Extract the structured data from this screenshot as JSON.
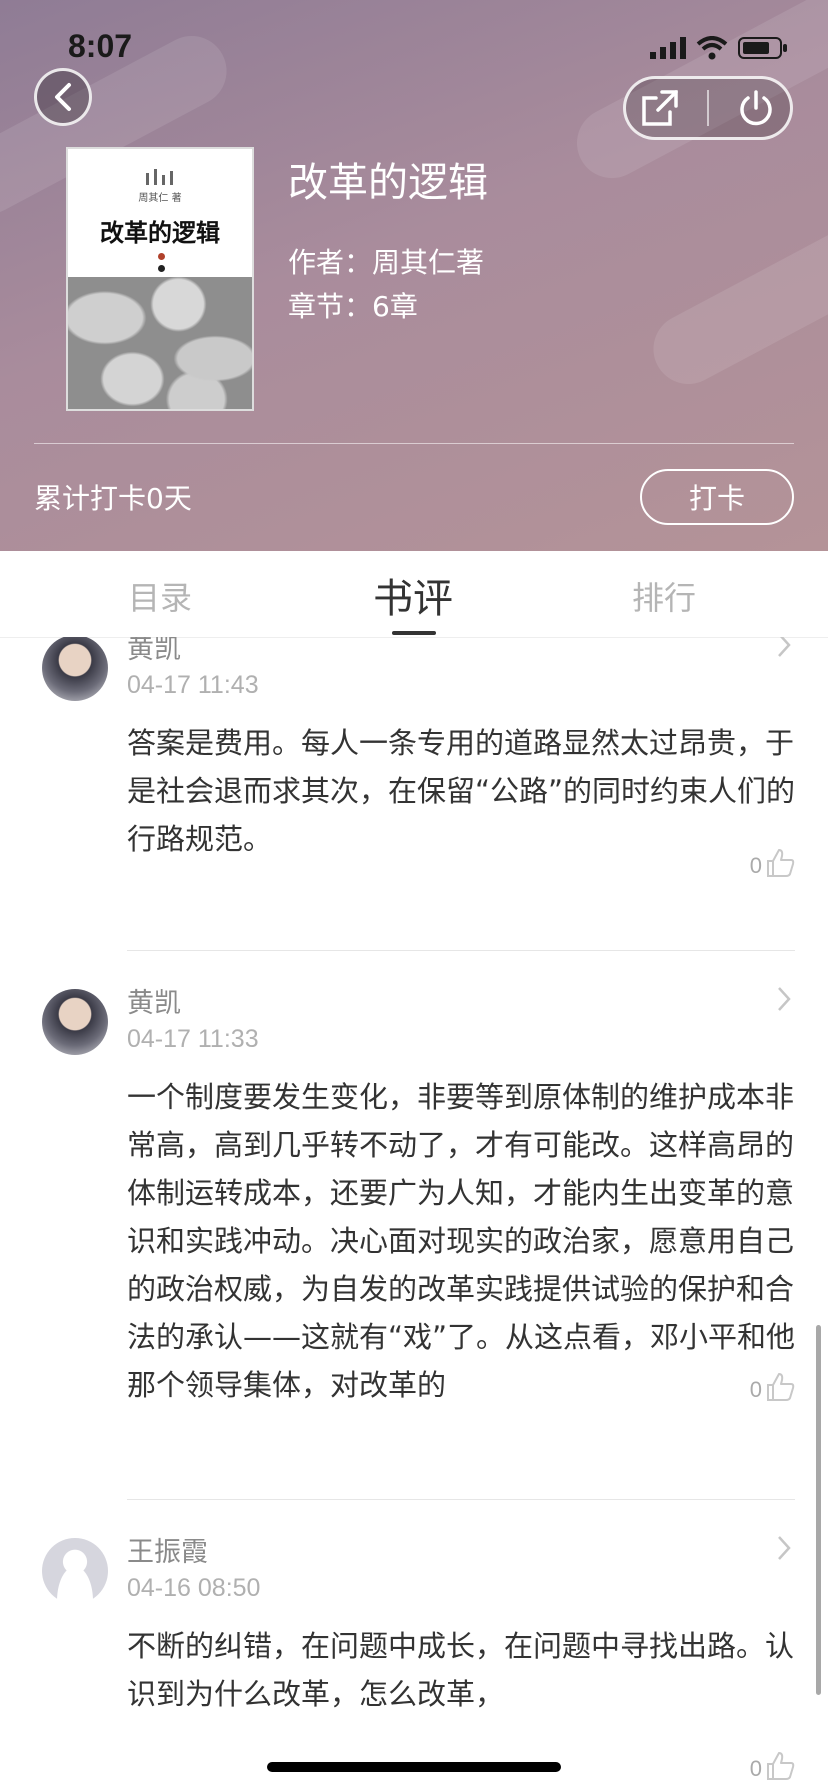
{
  "status_bar": {
    "time": "8:07"
  },
  "book": {
    "title": "改革的逻辑",
    "author_line": "作者：周其仁著",
    "chapters_line": "章节：6章",
    "cover_title": "改革的逻辑",
    "cover_author": "周其仁 著"
  },
  "checkin": {
    "count_text": "累计打卡0天",
    "button_label": "打卡"
  },
  "tabs": [
    {
      "label": "目录",
      "active": false
    },
    {
      "label": "书评",
      "active": true
    },
    {
      "label": "排行",
      "active": false
    }
  ],
  "reviews": [
    {
      "name": "黄凯",
      "date": "04-17 11:43",
      "text": "答案是费用。每人一条专用的道路显然太过昂贵，于是社会退而求其次，在保留“公路”的同时约束人们的行路规范。",
      "likes": "0"
    },
    {
      "name": "黄凯",
      "date": "04-17 11:33",
      "text": "一个制度要发生变化，非要等到原体制的维护成本非常高，高到几乎转不动了，才有可能改。这样高昂的体制运转成本，还要广为人知，才能内生出变革的意识和实践冲动。决心面对现实的政治家，愿意用自己的政治权威，为自发的改革实践提供试验的保护和合法的承认——这就有“戏”了。从这点看，邓小平和他那个领导集体，对改革的",
      "likes": "0"
    },
    {
      "name": "王振霞",
      "date": "04-16 08:50",
      "text": "不断的纠错，在问题中成长，在问题中寻找出路。认识到为什么改革，怎么改革，",
      "likes": "0"
    }
  ]
}
